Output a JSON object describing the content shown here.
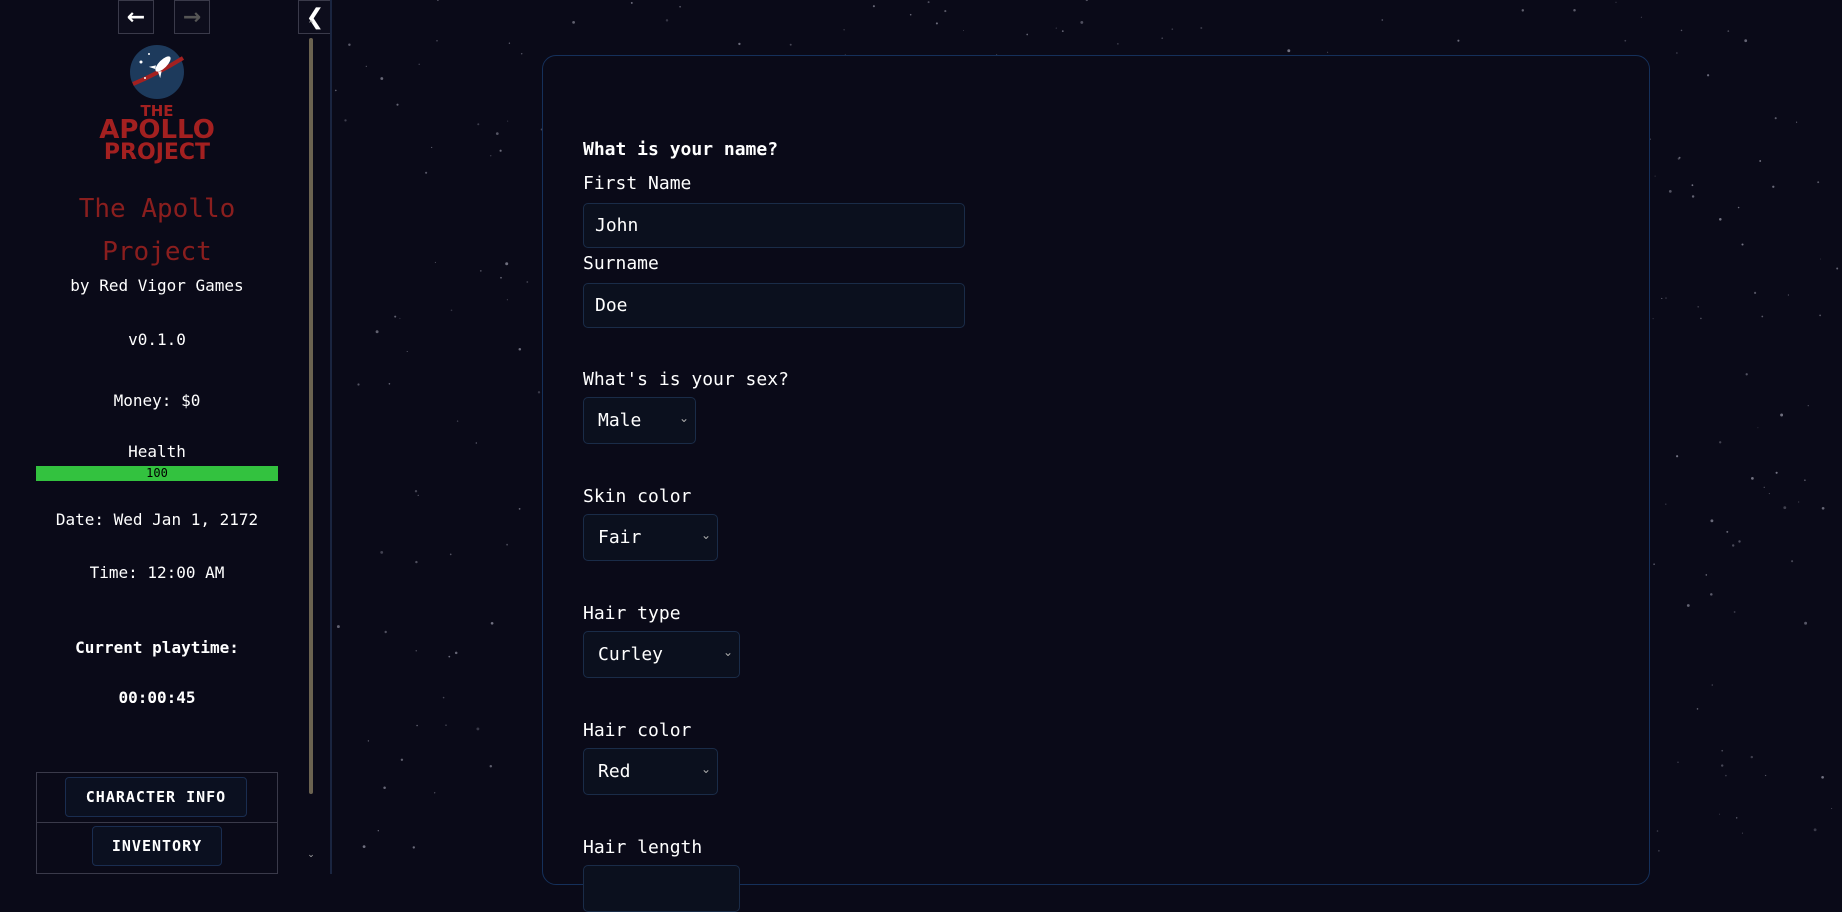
{
  "nav": {
    "back_icon": "arrow-left-icon",
    "forward_icon": "arrow-right-icon",
    "collapse_icon": "chevron-left-icon"
  },
  "sidebar": {
    "logo": {
      "line1": "THE",
      "line2": "APOLLO",
      "line3": "PROJECT"
    },
    "story_title": "The Apollo Project",
    "author": "by Red Vigor Games",
    "version": "v0.1.0",
    "money": "Money: $0",
    "health_label": "Health",
    "health_value": "100",
    "health_fraction": 1.0,
    "date": "Date: Wed Jan 1, 2172",
    "time": "Time: 12:00 AM",
    "playtime_label": "Current playtime:",
    "playtime_value": "00:00:45",
    "menu": [
      "CHARACTER INFO",
      "INVENTORY"
    ]
  },
  "form": {
    "name_question": "What is your name?",
    "first_name_label": "First Name",
    "first_name_value": "John",
    "surname_label": "Surname",
    "surname_value": "Doe",
    "sex_question": "What's is your sex?",
    "sex_value": "Male",
    "skin_label": "Skin color",
    "skin_value": "Fair",
    "hair_type_label": "Hair type",
    "hair_type_value": "Curley",
    "hair_color_label": "Hair color",
    "hair_color_value": "Red",
    "hair_length_label": "Hair length"
  },
  "colors": {
    "background": "#0a0a18",
    "title_red": "#8a1e1e",
    "health_green": "#33c23f",
    "panel_border": "#15305a"
  }
}
